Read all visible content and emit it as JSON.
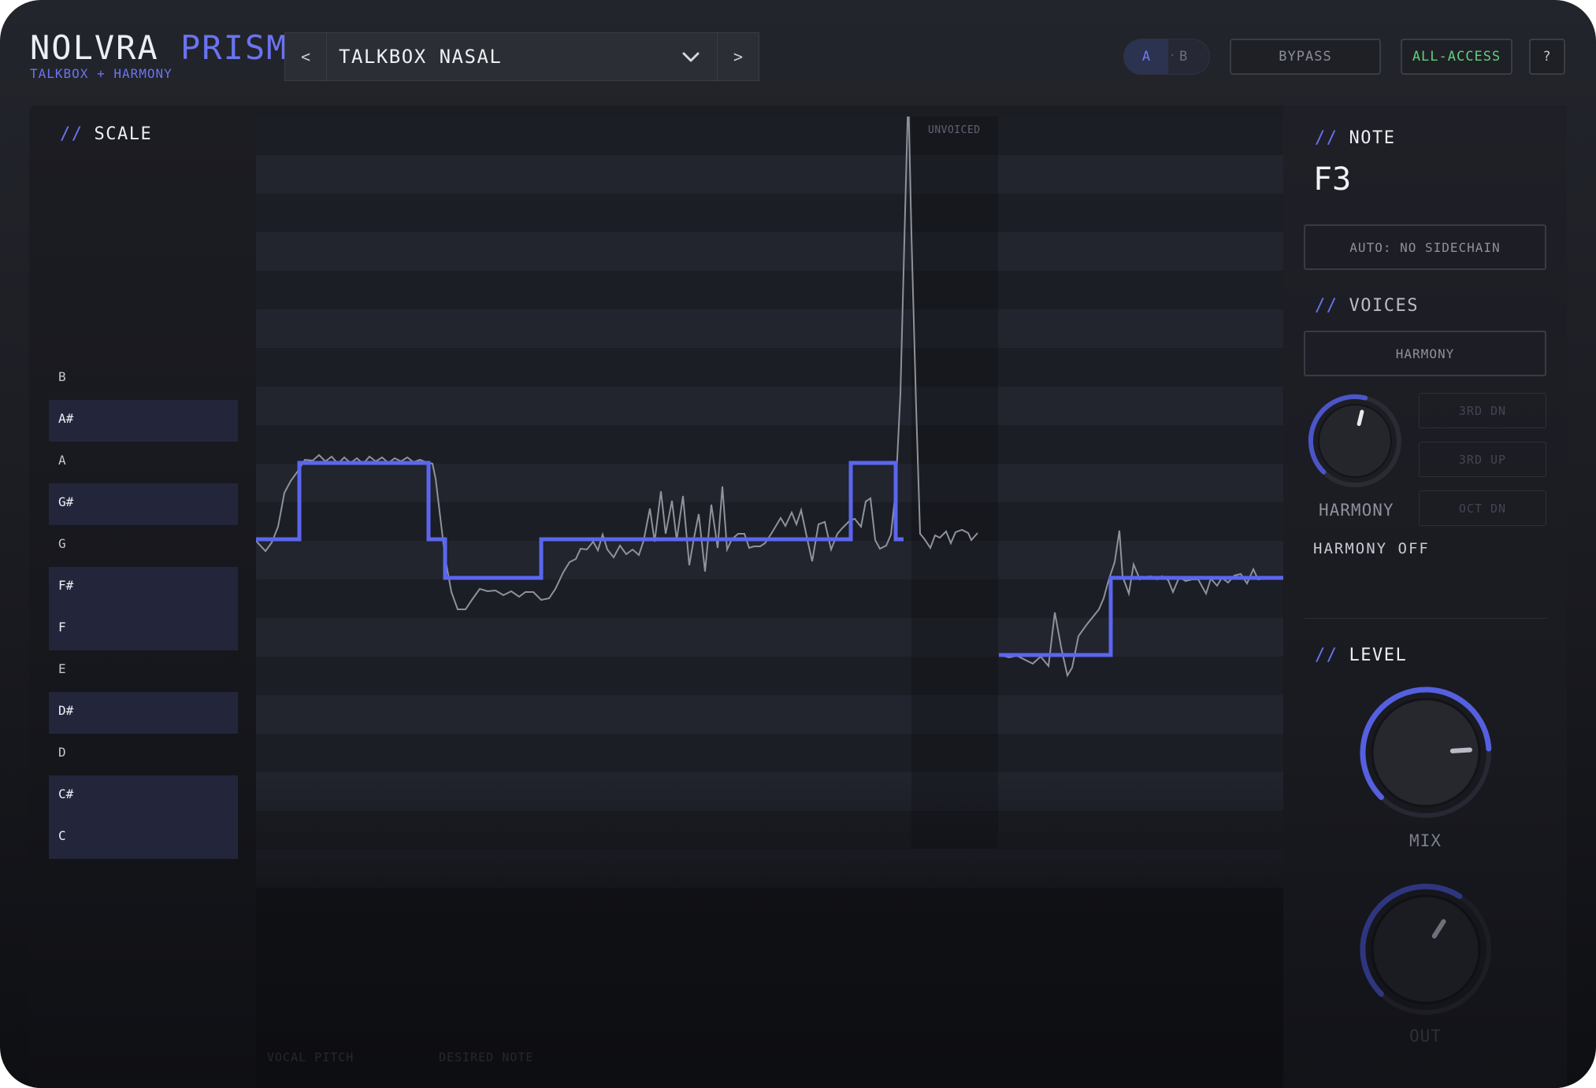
{
  "app": {
    "brand_name": "NOLVRA",
    "brand_accent": "PRISM",
    "subtitle": "TALKBOX + HARMONY"
  },
  "preset": {
    "prev_label": "<",
    "name": "TALKBOX NASAL",
    "next_label": ">"
  },
  "header": {
    "ab_a": "A",
    "ab_sep": "·",
    "ab_b": "B",
    "bypass_label": "BYPASS",
    "all_access_label": "ALL-ACCESS",
    "help_label": "?"
  },
  "scale": {
    "title": "SCALE",
    "notes": [
      {
        "name": "B",
        "enabled": false
      },
      {
        "name": "A#",
        "enabled": true
      },
      {
        "name": "A",
        "enabled": false
      },
      {
        "name": "G#",
        "enabled": true
      },
      {
        "name": "G",
        "enabled": false
      },
      {
        "name": "F#",
        "enabled": true
      },
      {
        "name": "F",
        "enabled": true
      },
      {
        "name": "E",
        "enabled": false
      },
      {
        "name": "D#",
        "enabled": true
      },
      {
        "name": "D",
        "enabled": false
      },
      {
        "name": "C#",
        "enabled": true
      },
      {
        "name": "C",
        "enabled": true
      }
    ]
  },
  "graph": {
    "unvoiced_label": "UNVOICED",
    "legend_vocal": "VOCAL PITCH",
    "legend_desired": "DESIRED NOTE"
  },
  "note_panel": {
    "title": "NOTE",
    "value": "F3",
    "auto_label": "AUTO: NO SIDECHAIN"
  },
  "voices": {
    "title": "VOICES",
    "mode_label": "HARMONY",
    "knob_label": "HARMONY",
    "status": "HARMONY OFF",
    "harmony_knob_value": 0.55,
    "options": [
      "3RD DN",
      "3RD UP",
      "OCT DN"
    ]
  },
  "level": {
    "title": "LEVEL",
    "mix_label": "MIX",
    "mix_value": 0.82,
    "out_label": "OUT",
    "out_value": 0.62
  },
  "colors": {
    "accent": "#6a74f0",
    "all_access": "#5ed07c",
    "background": "#1c1d23"
  }
}
